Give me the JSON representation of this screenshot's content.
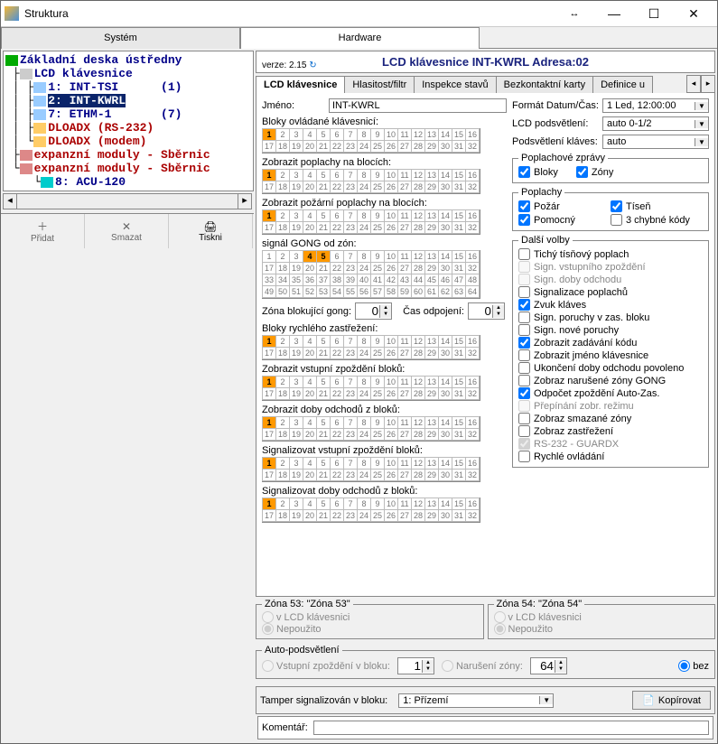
{
  "window": {
    "title": "Struktura"
  },
  "mainTabs": {
    "system": "Systém",
    "hardware": "Hardware"
  },
  "tree": {
    "root": "Základní deska ústředny",
    "n1": "LCD klávesnice",
    "n1a": "1: INT-TSI      (1)",
    "n1b": "2: INT-KWRL",
    "n1c": "7: ETHM-1       (7)",
    "n1d": "DLOADX (RS-232)",
    "n1e": "DLOADX (modem)",
    "n2": "expanzní moduly - Sběrnic",
    "n3": "expanzní moduly - Sběrnic",
    "n3a": "8: ACU-120"
  },
  "header": {
    "title": "LCD klávesnice INT-KWRL Adresa:02",
    "verLabel": "verze:",
    "ver": "2.15"
  },
  "subtabs": {
    "t1": "LCD klávesnice",
    "t2": "Hlasitost/filtr",
    "t3": "Inspekce stavů",
    "t4": "Bezkontaktní karty",
    "t5": "Definice u"
  },
  "left": {
    "nameLabel": "Jméno:",
    "name": "INT-KWRL",
    "s1": "Bloky ovládané klávesnicí:",
    "s2": "Zobrazit poplachy na blocích:",
    "s3": "Zobrazit požární poplachy na blocích:",
    "s4": "signál GONG od zón:",
    "zonaBlokLabel": "Zóna blokující gong:",
    "zonaBlokVal": "0",
    "casOdpLabel": "Čas odpojení:",
    "casOdpVal": "0",
    "s5": "Bloky rychlého zastřežení:",
    "s6": "Zobrazit vstupní zpoždění bloků:",
    "s7": "Zobrazit doby odchodů z bloků:",
    "s8": "Signalizovat vstupní zpoždění bloků:",
    "s9": "Signalizovat doby odchodů z bloků:"
  },
  "right": {
    "fmtLabel": "Formát Datum/Čas:",
    "fmtVal": "1 Led, 12:00:00",
    "lcdLabel": "LCD podsvětlení:",
    "lcdVal": "auto 0-1/2",
    "keyLabel": "Podsvětlení kláves:",
    "keyVal": "auto",
    "grp1": "Poplachové zprávy",
    "c_bloky": "Bloky",
    "c_zony": "Zóny",
    "grp2": "Poplachy",
    "c_pozar": "Požár",
    "c_pomoc": "Pomocný",
    "c_tisen": "Tíseň",
    "c_3kody": "3 chybné kódy",
    "grp3": "Další volby",
    "o1": "Tichý tísňový poplach",
    "o2": "Sign. vstupního zpoždění",
    "o3": "Sign. doby odchodu",
    "o4": "Signalizace poplachů",
    "o5": "Zvuk kláves",
    "o6": "Sign. poruchy v zas. bloku",
    "o7": "Sign. nové poruchy",
    "o8": "Zobrazit zadávání kódu",
    "o9": "Zobrazit jméno klávesnice",
    "o10": "Ukončení doby odchodu povoleno",
    "o11": "Zobraz narušené zóny GONG",
    "o12": "Odpočet zpoždění Auto-Zas.",
    "o13": "Přepínání zobr. režimu",
    "o14": "Zobraz smazané zóny",
    "o15": "Zobraz zastřežení",
    "o16": "RS-232 - GUARDX",
    "o17": "Rychlé ovládání"
  },
  "zone53": {
    "title": "Zóna 53: \"Zóna  53\"",
    "r1": "v LCD klávesnici",
    "r2": "Nepoužito"
  },
  "zone54": {
    "title": "Zóna 54: \"Zóna  54\"",
    "r1": "v LCD klávesnici",
    "r2": "Nepoužito"
  },
  "autopod": {
    "title": "Auto-podsvětlení",
    "r1": "Vstupní zpoždění v bloku:",
    "r1v": "1",
    "r2": "Narušení zóny:",
    "r2v": "64",
    "r3": "bez"
  },
  "tamper": {
    "label": "Tamper signalizován v bloku:",
    "val": "1: Přízemí"
  },
  "copyBtn": "Kopírovat",
  "toolbar": {
    "b1": "Přidat",
    "b2": "Smazat",
    "b3": "Tiskni"
  },
  "komentar": {
    "label": "Komentář:"
  }
}
